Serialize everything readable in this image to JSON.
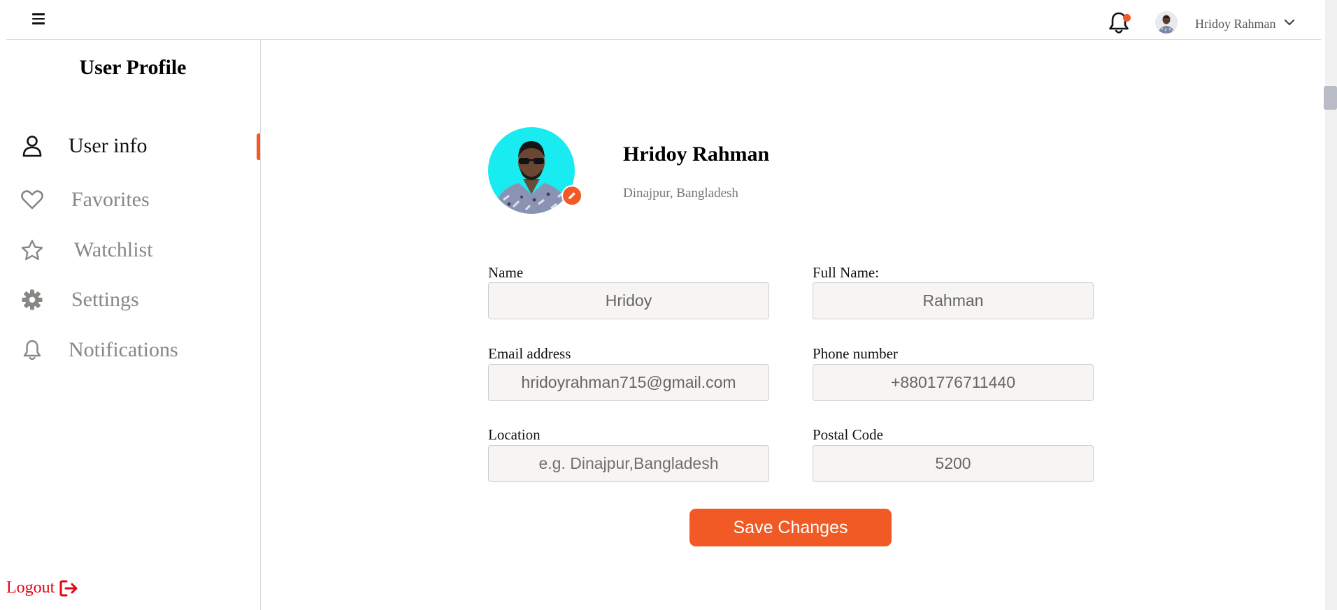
{
  "colors": {
    "accent": "#f15a24",
    "logout": "#e30613",
    "avatar_bg": "#19ecf0",
    "input_bg": "#f6f5f4"
  },
  "topbar": {
    "menu_icon": "hamburger-icon",
    "notification_icon": "bell-icon",
    "username": "Hridoy Rahman",
    "dropdown_icon": "chevron-down-icon"
  },
  "sidebar": {
    "title": "User Profile",
    "items": [
      {
        "label": "User info",
        "icon": "user-icon",
        "active": true
      },
      {
        "label": "Favorites",
        "icon": "heart-icon",
        "active": false
      },
      {
        "label": "Watchlist",
        "icon": "star-icon",
        "active": false
      },
      {
        "label": "Settings",
        "icon": "gear-icon",
        "active": false
      },
      {
        "label": "Notifications",
        "icon": "bell-icon",
        "active": false
      }
    ],
    "logout": {
      "label": "Logout",
      "icon": "logout-icon"
    }
  },
  "profile": {
    "name": "Hridoy Rahman",
    "location": "Dinajpur, Bangladesh",
    "edit_icon": "pencil-icon"
  },
  "form": {
    "name": {
      "label": "Name",
      "value": "Hridoy",
      "placeholder": ""
    },
    "full_name": {
      "label": "Full Name:",
      "value": "Rahman",
      "placeholder": ""
    },
    "email": {
      "label": "Email address",
      "value": "hridoyrahman715@gmail.com",
      "placeholder": ""
    },
    "phone": {
      "label": "Phone number",
      "value": "+8801776711440",
      "placeholder": ""
    },
    "location": {
      "label": "Location",
      "value": "",
      "placeholder": "e.g. Dinajpur,Bangladesh"
    },
    "postal_code": {
      "label": "Postal Code",
      "value": "5200",
      "placeholder": ""
    },
    "save_label": "Save Changes"
  }
}
